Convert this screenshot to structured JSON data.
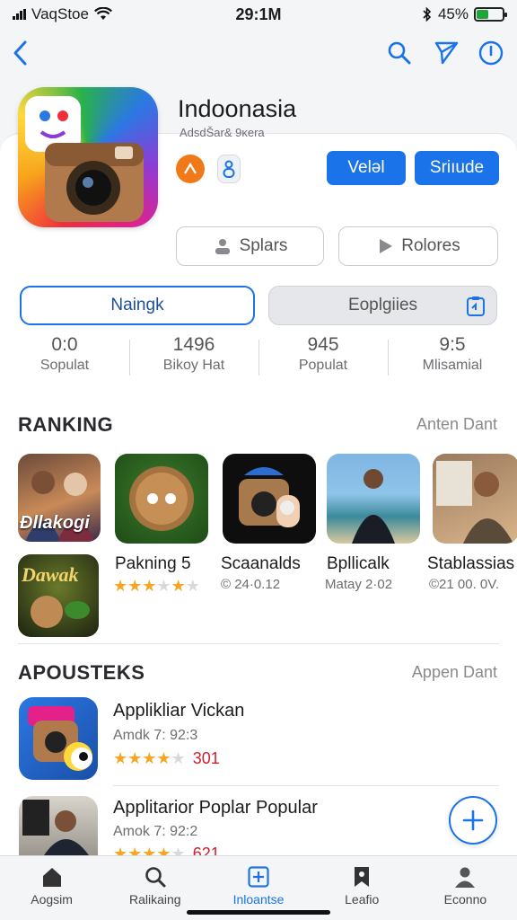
{
  "status_bar": {
    "carrier": "VaqStoe",
    "time": "29:1M",
    "battery": "45%",
    "battery_level": 0.45
  },
  "app": {
    "title": "Indoonasia",
    "subtitle": "AdsdŠar& 9ĸera",
    "primary_button": "Veləl",
    "secondary_button": "Sriıude",
    "outline_left": "Splars",
    "outline_right": "Rolores"
  },
  "segments": {
    "active": "Naingk",
    "inactive": "Eoplgiies"
  },
  "stats": [
    {
      "value": "0:0",
      "label": "Sopulat"
    },
    {
      "value": "1496",
      "label": "Bikoy Hat"
    },
    {
      "value": "945",
      "label": "Populat"
    },
    {
      "value": "9:5",
      "label": "Mlisamial"
    }
  ],
  "ranking": {
    "title": "RANKING",
    "link": "Anten Dant",
    "first_thumb_text": "Ðllakogi",
    "items": [
      {
        "name": "Pakning 5",
        "meta": "",
        "stars": 3.5
      },
      {
        "name": "Scaanalds",
        "meta": "© 24·0.12"
      },
      {
        "name": "Bpllicalk",
        "meta": "Matay 2·02"
      },
      {
        "name": "Stablassias",
        "meta": "©21 00. 0V."
      }
    ]
  },
  "apousteks": {
    "title": "APOUSTEKS",
    "link": "Appen Dant",
    "items": [
      {
        "name": "Applikliar Vickan",
        "sub": "Amdk 7: 92:3",
        "stars": 3.5,
        "count": "301"
      },
      {
        "name": "Applitarior Poplar Popular",
        "sub": "Amok 7: 92:2",
        "stars": 3.5,
        "count": "621"
      }
    ]
  },
  "tabs": [
    {
      "label": "Aogsim",
      "icon": "home-icon"
    },
    {
      "label": "Ralikaing",
      "icon": "search-icon"
    },
    {
      "label": "Inloantse",
      "icon": "add-square-icon"
    },
    {
      "label": "Leafio",
      "icon": "bookmark-icon"
    },
    {
      "label": "Econno",
      "icon": "profile-icon"
    }
  ],
  "colors": {
    "accent": "#1a73e8",
    "star": "#f5a623",
    "count_red": "#d0202e"
  }
}
